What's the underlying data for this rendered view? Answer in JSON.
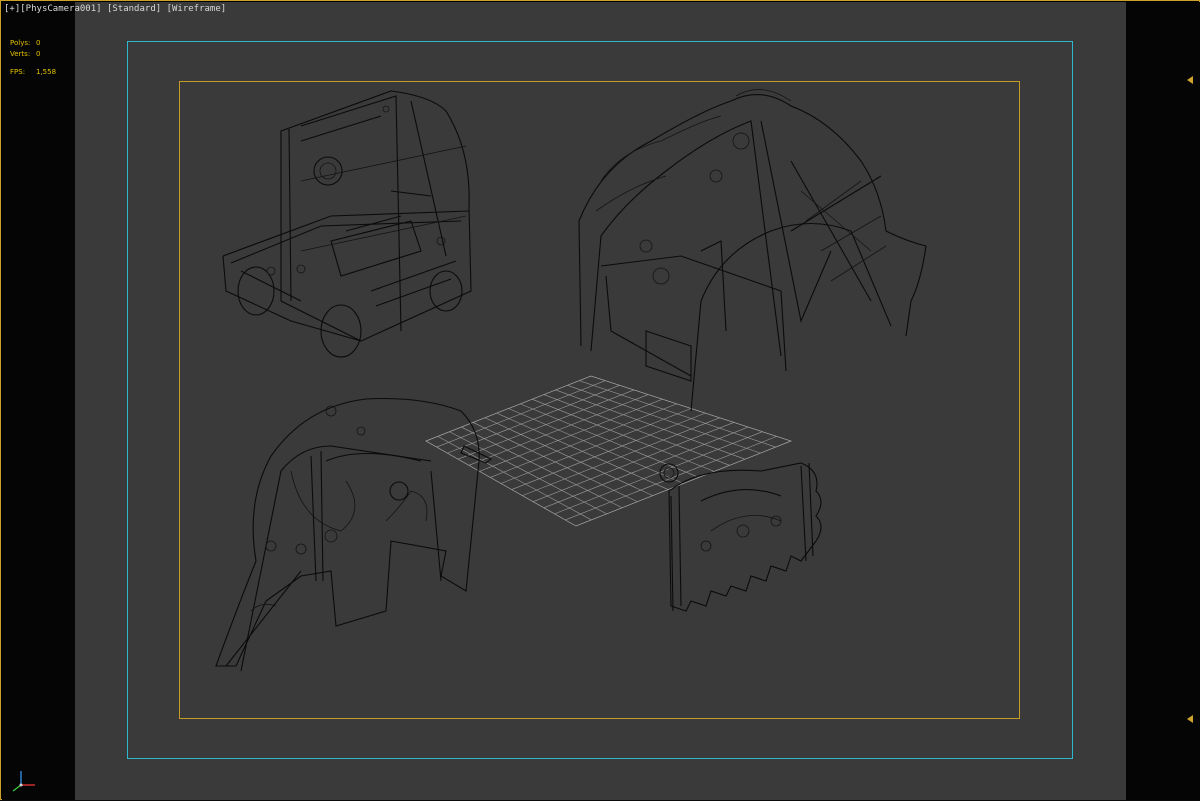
{
  "viewport": {
    "labels": [
      {
        "id": "menu",
        "text": "[+]"
      },
      {
        "id": "camera",
        "text": "[PhysCamera001]"
      },
      {
        "id": "shading_preset",
        "text": "[Standard]"
      },
      {
        "id": "display_mode",
        "text": "[Wireframe]"
      }
    ],
    "view_mode": "wireframe"
  },
  "stats": {
    "polys_label": "Polys:",
    "polys_value": "0",
    "verts_label": "Verts:",
    "verts_value": "0",
    "fps_label": "FPS:",
    "fps_value": "1,558"
  },
  "colors": {
    "viewport_border": "#c9a227",
    "safe_frame": "#2fb7c9",
    "camera_frame": "#c59a27",
    "stats_text": "#e6c300",
    "background": "#3a3a3a"
  },
  "icons": {
    "right_arrow_top": "triangle-left-icon",
    "right_arrow_bottom": "triangle-left-icon",
    "axis": "xyz-axis-gizmo-icon"
  }
}
